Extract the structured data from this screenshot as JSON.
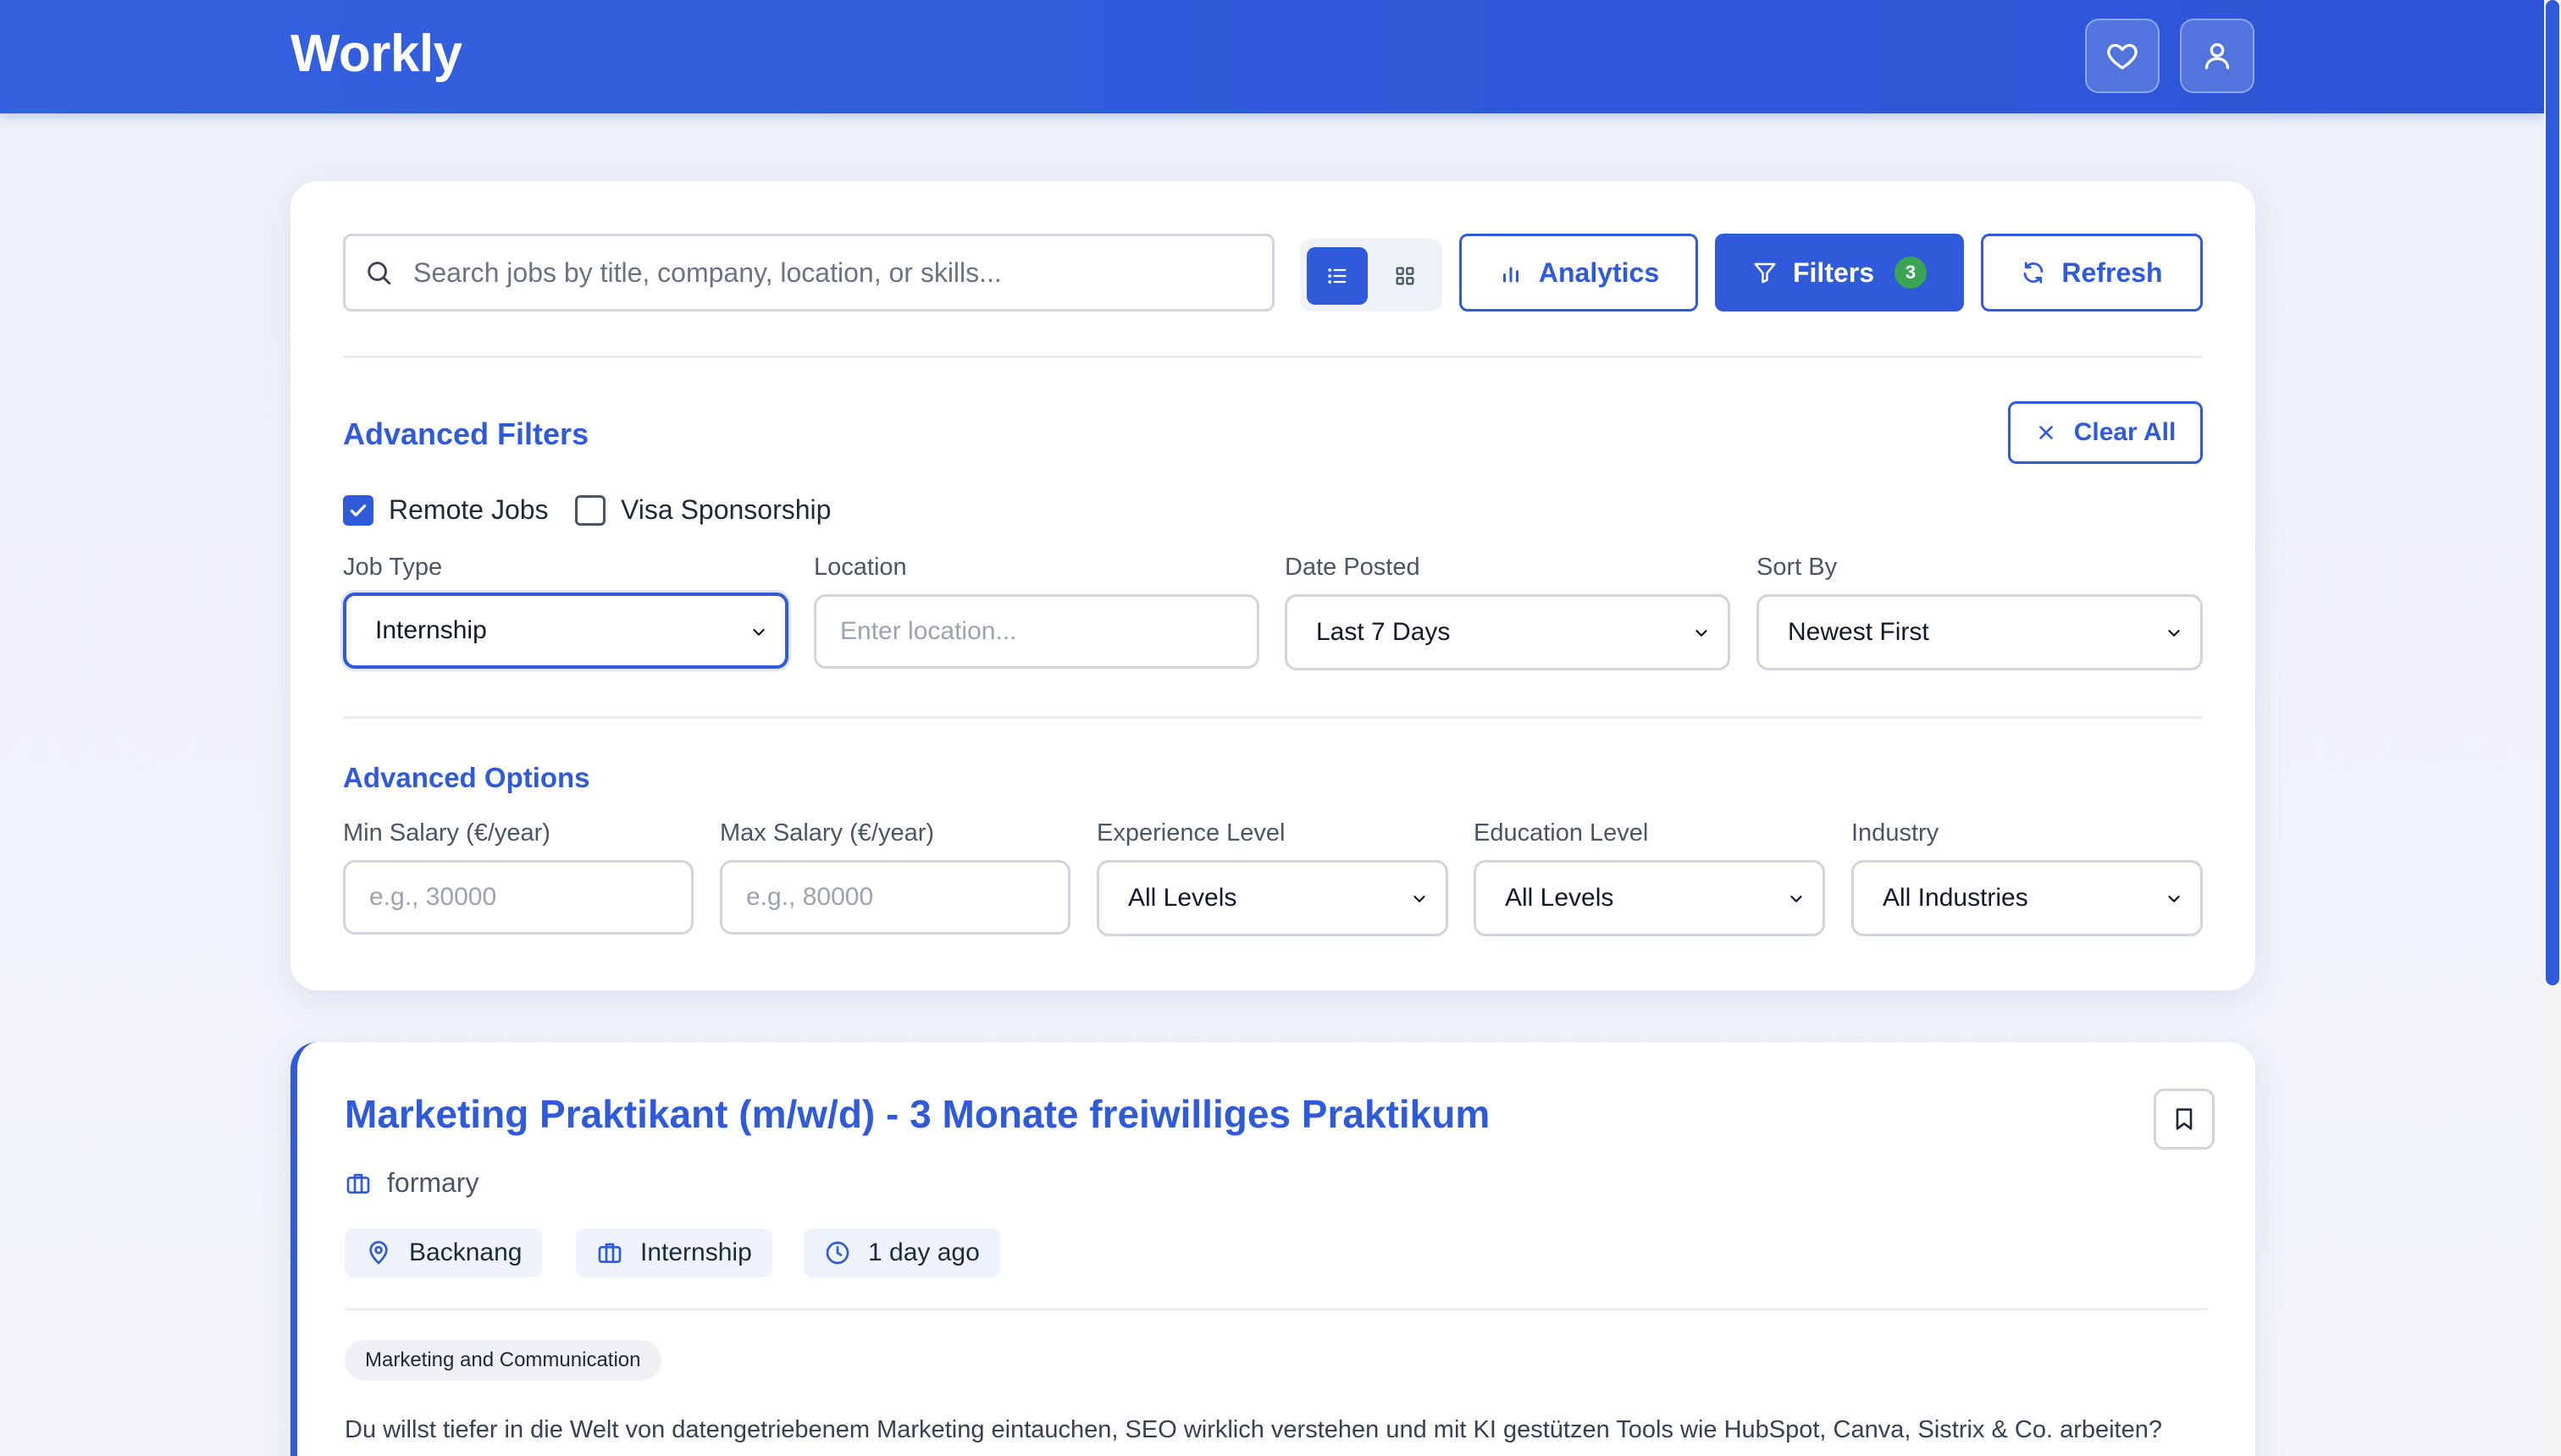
{
  "app": {
    "brand": "Workly"
  },
  "header": {
    "favorites_icon": "heart-icon",
    "profile_icon": "user-icon"
  },
  "toolbar": {
    "search_placeholder": "Search jobs by title, company, location, or skills...",
    "view_mode": "list",
    "analytics_label": "Analytics",
    "filters_label": "Filters",
    "filters_count": "3",
    "refresh_label": "Refresh"
  },
  "filters": {
    "title": "Advanced Filters",
    "clear_label": "Clear All",
    "remote_jobs": {
      "label": "Remote Jobs",
      "checked": true
    },
    "visa_sponsorship": {
      "label": "Visa Sponsorship",
      "checked": false
    },
    "job_type": {
      "label": "Job Type",
      "value": "Internship"
    },
    "location": {
      "label": "Location",
      "placeholder": "Enter location..."
    },
    "date_posted": {
      "label": "Date Posted",
      "value": "Last 7 Days"
    },
    "sort_by": {
      "label": "Sort By",
      "value": "Newest First"
    }
  },
  "advanced_options": {
    "title": "Advanced Options",
    "min_salary": {
      "label": "Min Salary (€/year)",
      "placeholder": "e.g., 30000"
    },
    "max_salary": {
      "label": "Max Salary (€/year)",
      "placeholder": "e.g., 80000"
    },
    "experience": {
      "label": "Experience Level",
      "value": "All Levels"
    },
    "education": {
      "label": "Education Level",
      "value": "All Levels"
    },
    "industry": {
      "label": "Industry",
      "value": "All Industries"
    }
  },
  "jobs": [
    {
      "title": "Marketing Praktikant (m/w/d) - 3 Monate freiwilliges Praktikum",
      "company": "formary",
      "location": "Backnang",
      "type": "Internship",
      "posted": "1 day ago",
      "category": "Marketing and Communication",
      "description": "Du willst tiefer in die Welt von datengetriebenem Marketing eintauchen, SEO wirklich verstehen und mit KI gestützen Tools wie HubSpot, Canva, Sistrix & Co. arbeiten?"
    }
  ],
  "colors": {
    "accent": "#2f5bdb",
    "badge": "#3aa655"
  }
}
